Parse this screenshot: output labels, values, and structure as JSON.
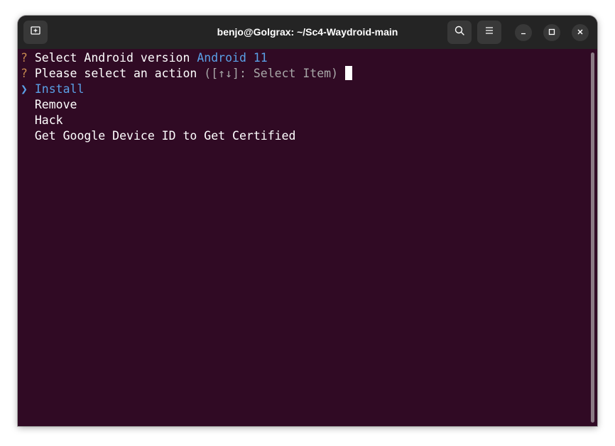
{
  "window": {
    "title": "benjo@Golgrax: ~/Sc4-Waydroid-main"
  },
  "titlebar": {
    "new_tab_icon": "new-tab-icon",
    "search_icon": "search-icon",
    "menu_icon": "hamburger-menu-icon",
    "minimize_icon": "minimize-icon",
    "maximize_icon": "maximize-icon",
    "close_icon": "close-icon"
  },
  "terminal": {
    "prompt1": {
      "marker": "?",
      "text": "Select Android version",
      "answer": "Android 11"
    },
    "prompt2": {
      "marker": "?",
      "text": "Please select an action",
      "hint": "([↑↓]: Select Item)"
    },
    "selector": "❯",
    "menu_items": [
      "Install",
      "Remove",
      "Hack",
      "Get Google Device ID to Get Certified"
    ],
    "selected_index": 0
  },
  "colors": {
    "terminal_bg": "#300a24",
    "titlebar_bg": "#242424",
    "accent": "#5aa0e6",
    "question_mark": "#c4874f"
  }
}
